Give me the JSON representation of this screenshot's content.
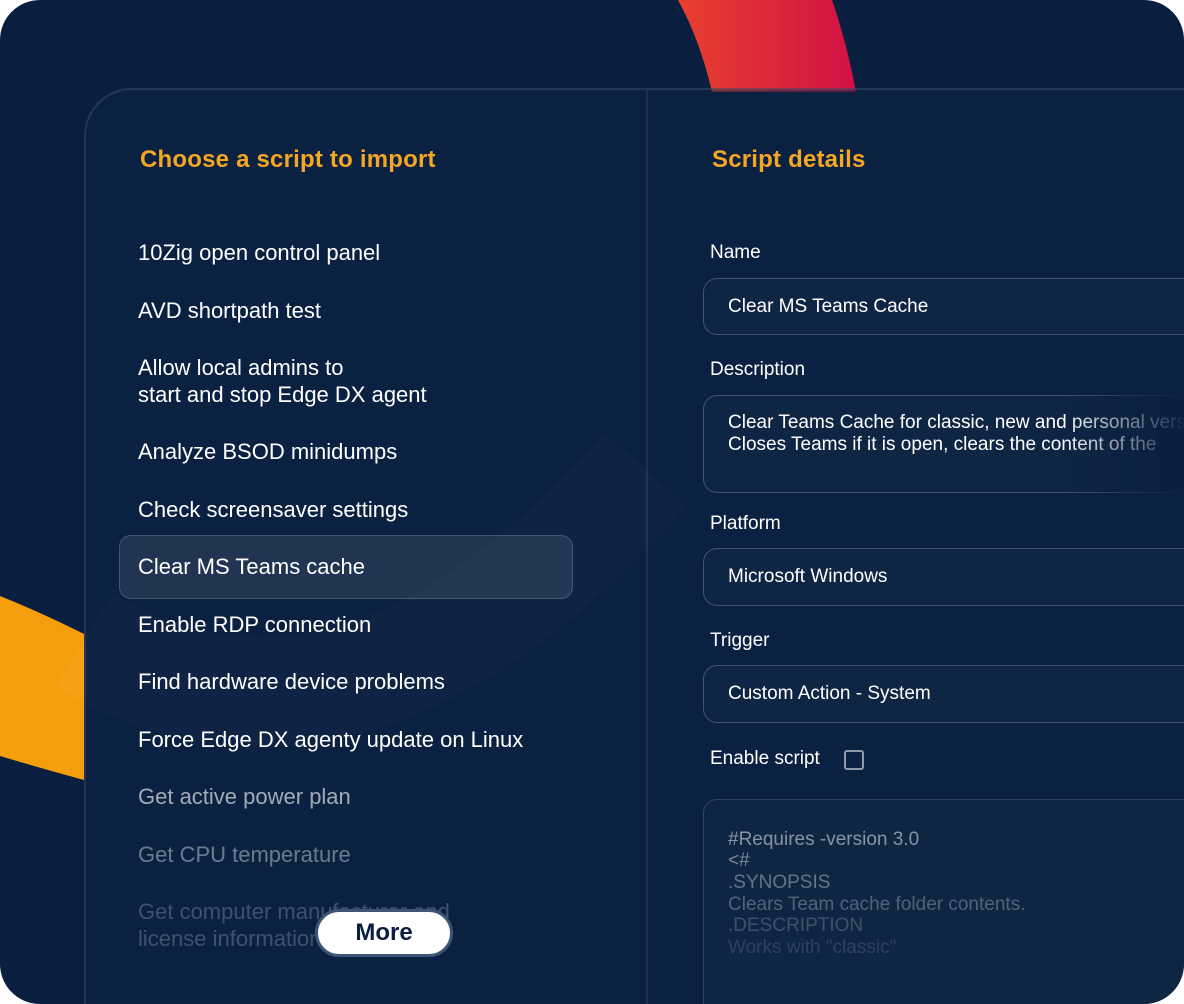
{
  "left": {
    "title": "Choose a script to import",
    "items": [
      {
        "label": "10Zig open control panel"
      },
      {
        "label": "AVD shortpath test"
      },
      {
        "label": "Allow local admins to\nstart and stop Edge DX agent"
      },
      {
        "label": "Analyze BSOD minidumps"
      },
      {
        "label": "Check screensaver settings"
      },
      {
        "label": "Clear MS Teams cache"
      },
      {
        "label": "Enable RDP connection"
      },
      {
        "label": "Find hardware device problems"
      },
      {
        "label": "Force Edge DX agenty update on Linux"
      },
      {
        "label": "Get active power plan"
      },
      {
        "label": "Get CPU temperature"
      },
      {
        "label": "Get computer manufacturer and\nlicense information"
      }
    ],
    "selected_index": 5,
    "more_label": "More"
  },
  "right": {
    "title": "Script details",
    "name_label": "Name",
    "name_value": "Clear MS Teams Cache",
    "description_label": "Description",
    "description_lines": [
      "Clear Teams Cache for classic, new and personal versions.",
      "Closes Teams if it is open, clears the content of the"
    ],
    "platform_label": "Platform",
    "platform_value": "Microsoft Windows",
    "trigger_label": "Trigger",
    "trigger_value": "Custom Action - System",
    "enable_label": "Enable script",
    "enable_checked": false,
    "code_lines": [
      "#Requires -version 3.0",
      "<#",
      ".SYNOPSIS",
      "Clears Team cache folder contents.",
      ".DESCRIPTION",
      "Works with \"classic\""
    ]
  },
  "colors": {
    "background": "#0a1f3f",
    "accent": "#f5a623",
    "decor_red": "#e0243c",
    "decor_orange": "#f5a00f"
  }
}
